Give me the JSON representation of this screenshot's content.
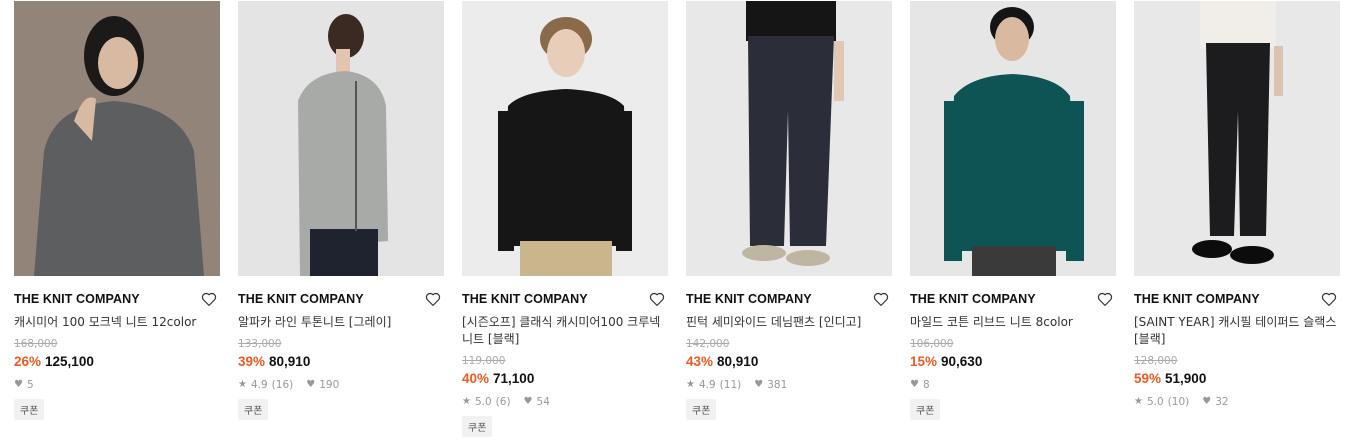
{
  "products": [
    {
      "brand": "THE KNIT COMPANY",
      "name": "캐시미어 100 모크넥 니트 12color",
      "original_price": "168,000",
      "discount": "26%",
      "price": "125,100",
      "rating": "",
      "reviews": "",
      "likes": "5",
      "coupon": "쿠폰",
      "bg": "#8a7a70",
      "garment": "#5e5e5f"
    },
    {
      "brand": "THE KNIT COMPANY",
      "name": "알파카 라인 투톤니트 [그레이]",
      "original_price": "133,000",
      "discount": "39%",
      "price": "80,910",
      "rating": "4.9",
      "reviews": "(16)",
      "likes": "190",
      "coupon": "쿠폰",
      "bg": "#e6e6e6",
      "garment": "#a7a9a6"
    },
    {
      "brand": "THE KNIT COMPANY",
      "name": "[시즌오프] 클래식 캐시미어100 크루넥니트 [블랙]",
      "original_price": "119,000",
      "discount": "40%",
      "price": "71,100",
      "rating": "5.0",
      "reviews": "(6)",
      "likes": "54",
      "coupon": "쿠폰",
      "bg": "#ececec",
      "garment": "#1a1a1a"
    },
    {
      "brand": "THE KNIT COMPANY",
      "name": "핀턱 세미와이드 데님팬츠 [인디고]",
      "original_price": "142,000",
      "discount": "43%",
      "price": "80,910",
      "rating": "4.9",
      "reviews": "(11)",
      "likes": "381",
      "coupon": "쿠폰",
      "bg": "#e9e9e9",
      "garment": "#2a2d38"
    },
    {
      "brand": "THE KNIT COMPANY",
      "name": "마일드 코튼 리브드 니트 8color",
      "original_price": "106,000",
      "discount": "15%",
      "price": "90,630",
      "rating": "",
      "reviews": "",
      "likes": "8",
      "coupon": "쿠폰",
      "bg": "#e7e7e7",
      "garment": "#0f5455"
    },
    {
      "brand": "THE KNIT COMPANY",
      "name": "[SAINT YEAR] 캐시필 테이퍼드 슬랙스 [블랙]",
      "original_price": "128,000",
      "discount": "59%",
      "price": "51,900",
      "rating": "5.0",
      "reviews": "(10)",
      "likes": "32",
      "coupon": "",
      "bg": "#e9e9e9",
      "garment": "#1c1c1f"
    }
  ],
  "icons": {
    "wishlist": "heart-outline-icon",
    "star": "star-icon",
    "like": "heart-filled-icon"
  }
}
